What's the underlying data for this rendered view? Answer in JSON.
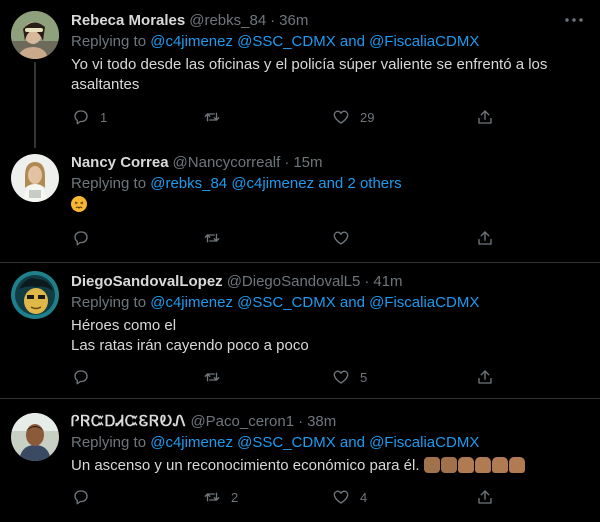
{
  "colors": {
    "background": "#000000",
    "text": "#d9d9d9",
    "muted": "#6e767d",
    "link": "#1d9bf0",
    "divider": "#2f3336"
  },
  "tweets": [
    {
      "name": "Rebeca Morales",
      "handle": "@rebks_84",
      "dot": "·",
      "time": "36m",
      "replying_prefix": "Replying to",
      "replying_links": "@c4jimenez @SSC_CDMX and @FiscaliaCDMX",
      "text_lines": [
        "Yo vi todo desde las oficinas y el policía súper valiente se enfrentó a los",
        "asaltantes"
      ],
      "reply_count": "1",
      "retweet_count": "",
      "like_count": "29"
    },
    {
      "name": "Nancy Correa",
      "handle": "@Nancycorrealf",
      "dot": "·",
      "time": "15m",
      "replying_prefix": "Replying to",
      "replying_links": "@rebks_84 @c4jimenez and 2 others",
      "emojis": [
        "persevering-face-emoji"
      ],
      "reply_count": "",
      "retweet_count": "",
      "like_count": ""
    },
    {
      "name": "DiegoSandovalLopez",
      "handle": "@DiegoSandovalL5",
      "dot": "·",
      "time": "41m",
      "replying_prefix": "Replying to",
      "replying_links": "@c4jimenez @SSC_CDMX and @FiscaliaCDMX",
      "text_lines": [
        "Héroes como el",
        "Las ratas irán cayendo poco a poco"
      ],
      "reply_count": "",
      "retweet_count": "",
      "like_count": "5"
    },
    {
      "name": "ᎵᏒᏨᎠᏗᏨᏋᏒᎧᏁ",
      "handle": "@Paco_ceron1",
      "dot": "·",
      "time": "38m",
      "replying_prefix": "Replying to",
      "replying_links": "@c4jimenez @SSC_CDMX and @FiscaliaCDMX",
      "text_lines": [
        "Un ascenso y un reconocimiento económico para él."
      ],
      "emojis": [
        "thumbs-up-emoji",
        "thumbs-up-emoji",
        "clapping-hands-emoji",
        "clapping-hands-emoji",
        "clapping-hands-emoji",
        "clapping-hands-emoji"
      ],
      "reply_count": "",
      "retweet_count": "2",
      "like_count": "4"
    }
  ],
  "icons": {
    "reply": "reply-icon",
    "retweet": "retweet-icon",
    "like": "heart-icon",
    "share": "share-icon",
    "more": "more-options-icon"
  }
}
